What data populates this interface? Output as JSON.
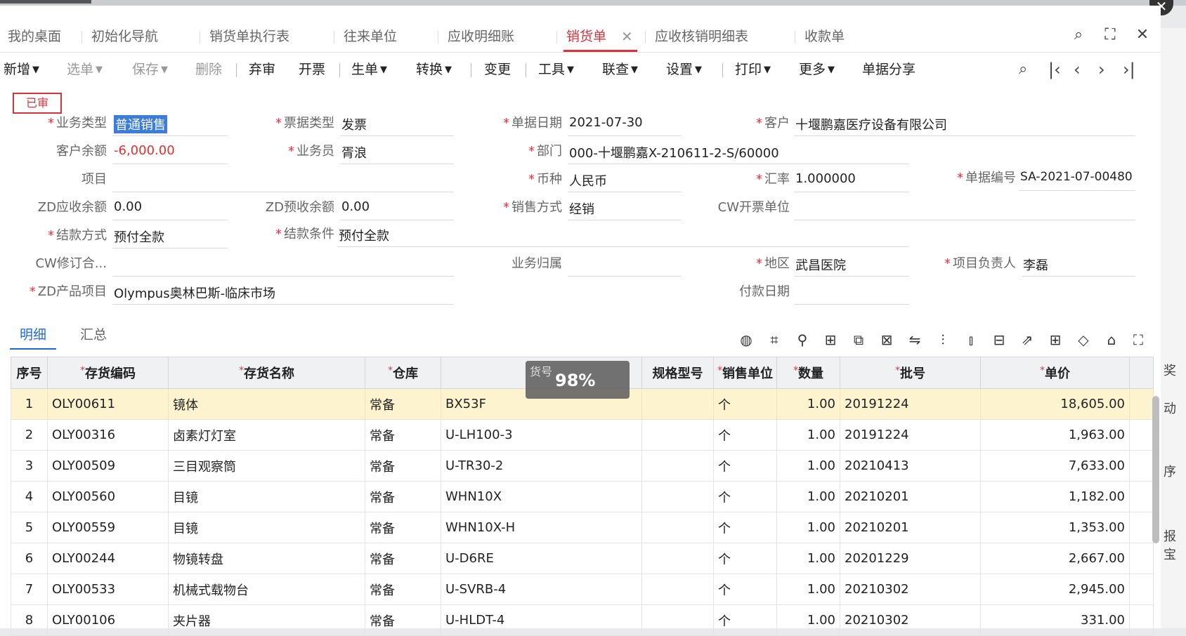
{
  "tabs": [
    {
      "label": "我的桌面"
    },
    {
      "label": "初始化导航"
    },
    {
      "label": "销货单执行表"
    },
    {
      "label": "往来单位"
    },
    {
      "label": "应收明细账"
    },
    {
      "label": "销货单",
      "active": true
    },
    {
      "label": "应收核销明细表"
    },
    {
      "label": "收款单"
    }
  ],
  "toolbar": {
    "new": "新增",
    "pick": "选单",
    "save": "保存",
    "delete": "删除",
    "unaudit": "弃审",
    "invoice": "开票",
    "generate": "生单",
    "convert": "转换",
    "change": "变更",
    "tools": "工具",
    "linkquery": "联查",
    "settings": "设置",
    "print": "打印",
    "more": "更多",
    "share": "单据分享"
  },
  "status_badge": "已审",
  "form": {
    "biz_type": {
      "label": "业务类型",
      "value": "普通销售"
    },
    "bill_type": {
      "label": "票据类型",
      "value": "发票"
    },
    "doc_date": {
      "label": "单据日期",
      "value": "2021-07-30"
    },
    "customer": {
      "label": "客户",
      "value": "十堰鹏嘉医疗设备有限公司"
    },
    "cust_balance": {
      "label": "客户余额",
      "value": "-6,000.00"
    },
    "salesman": {
      "label": "业务员",
      "value": "胥浪"
    },
    "dept": {
      "label": "部门",
      "value": "000-十堰鹏嘉X-210611-2-S/60000"
    },
    "project": {
      "label": "项目",
      "value": ""
    },
    "currency": {
      "label": "币种",
      "value": "人民币"
    },
    "rate": {
      "label": "汇率",
      "value": "1.000000"
    },
    "doc_no": {
      "label": "单据编号",
      "value": "SA-2021-07-00480"
    },
    "zd_recv": {
      "label": "ZD应收余额",
      "value": "0.00"
    },
    "zd_prerecv": {
      "label": "ZD预收余额",
      "value": "0.00"
    },
    "sales_mode": {
      "label": "销售方式",
      "value": "经销"
    },
    "cw_invoice_unit": {
      "label": "CW开票单位",
      "value": ""
    },
    "settle_mode": {
      "label": "结款方式",
      "value": "预付全款"
    },
    "settle_cond": {
      "label": "结款条件",
      "value": "预付全款"
    },
    "cw_contract": {
      "label": "CW修订合...",
      "value": ""
    },
    "biz_owner": {
      "label": "业务归属",
      "value": ""
    },
    "region": {
      "label": "地区",
      "value": "武昌医院"
    },
    "proj_lead": {
      "label": "项目负责人",
      "value": "李磊"
    },
    "zd_product": {
      "label": "ZD产品项目",
      "value": "Olympus奥林巴斯-临床市场"
    },
    "pay_date": {
      "label": "付款日期",
      "value": ""
    }
  },
  "detail_tabs": [
    "明细",
    "汇总"
  ],
  "table": {
    "headers": [
      "序号",
      "存货编码",
      "存货名称",
      "仓库",
      "货号",
      "规格型号",
      "销售单位",
      "数量",
      "批号",
      "单价"
    ],
    "rows": [
      [
        "1",
        "OLY00611",
        "镜体",
        "常备",
        "BX53F",
        "",
        "个",
        "1.00",
        "20191224",
        "18,605.00"
      ],
      [
        "2",
        "OLY00316",
        "卤素灯灯室",
        "常备",
        "U-LH100-3",
        "",
        "个",
        "1.00",
        "20191224",
        "1,963.00"
      ],
      [
        "3",
        "OLY00509",
        "三目观察筒",
        "常备",
        "U-TR30-2",
        "",
        "个",
        "1.00",
        "20210413",
        "7,633.00"
      ],
      [
        "4",
        "OLY00560",
        "目镜",
        "常备",
        "WHN10X",
        "",
        "个",
        "1.00",
        "20210201",
        "1,182.00"
      ],
      [
        "5",
        "OLY00559",
        "目镜",
        "常备",
        "WHN10X-H",
        "",
        "个",
        "1.00",
        "20210201",
        "1,353.00"
      ],
      [
        "6",
        "OLY00244",
        "物镜转盘",
        "常备",
        "U-D6RE",
        "",
        "个",
        "1.00",
        "20201229",
        "2,667.00"
      ],
      [
        "7",
        "OLY00533",
        "机械式载物台",
        "常备",
        "U-SVRB-4",
        "",
        "个",
        "1.00",
        "20210302",
        "2,945.00"
      ],
      [
        "8",
        "OLY00106",
        "夹片器",
        "常备",
        "U-HLDT-4",
        "",
        "个",
        "1.00",
        "20210302",
        "331.00"
      ]
    ]
  },
  "progress": {
    "label": "货号",
    "value": "98%"
  },
  "side_fragments": [
    "奖",
    "动",
    "序",
    "报宝"
  ]
}
